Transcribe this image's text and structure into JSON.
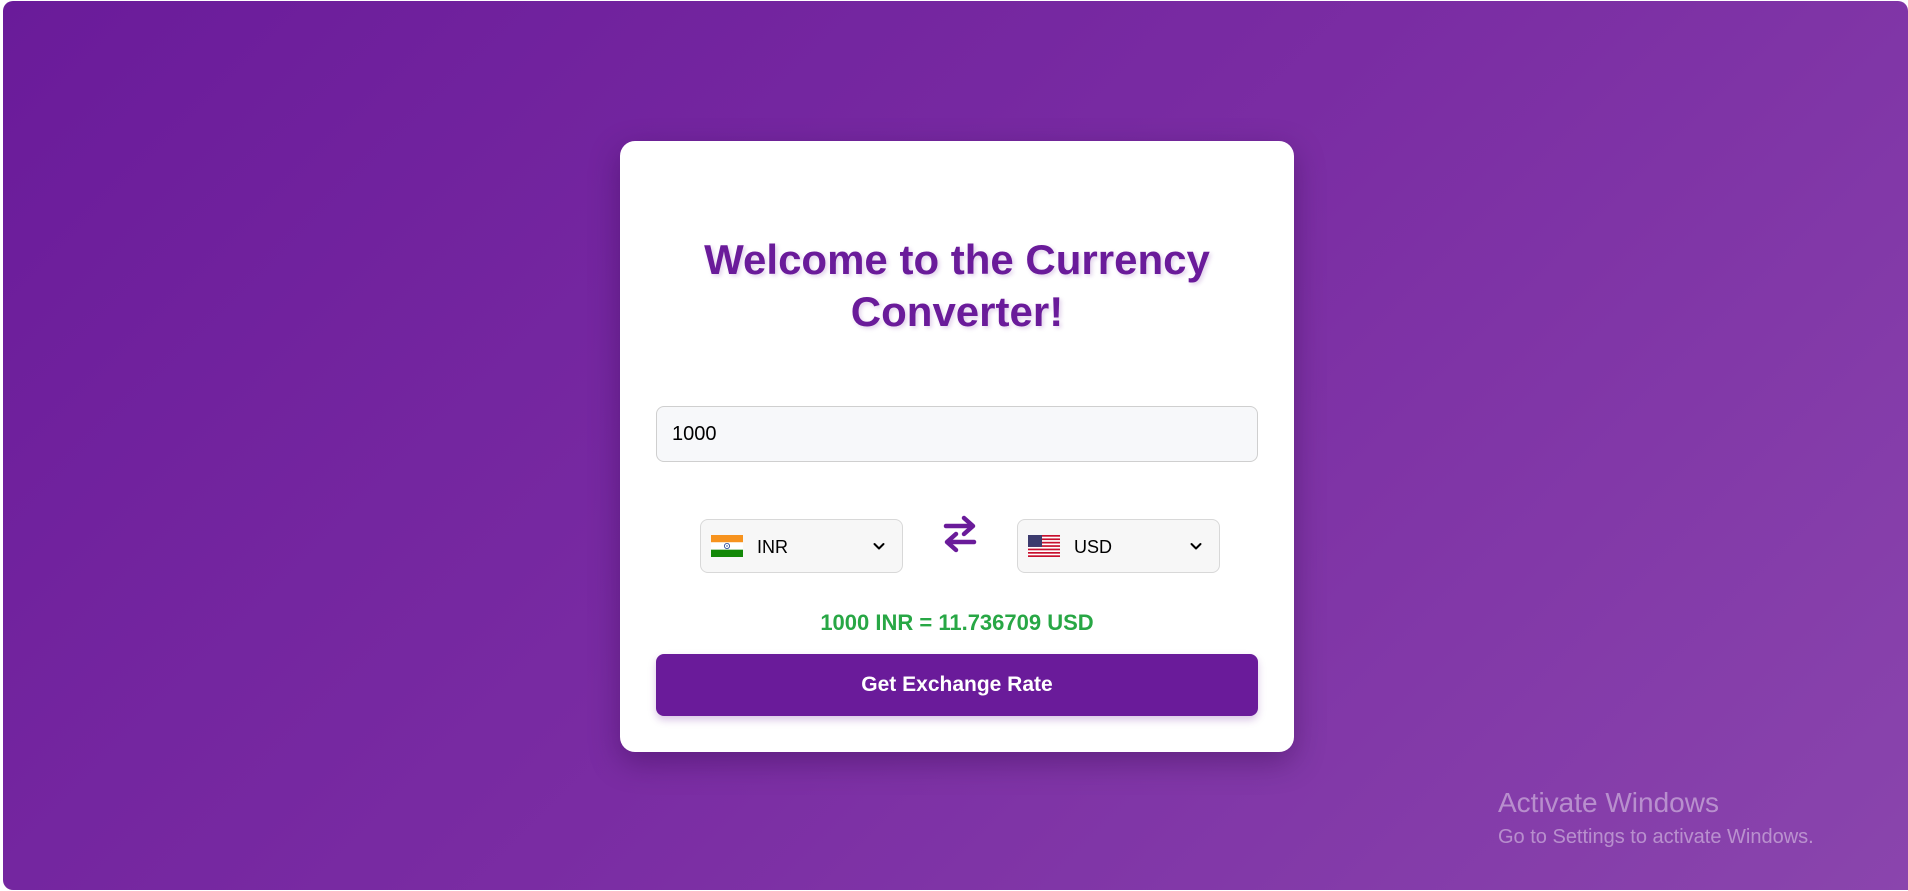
{
  "colors": {
    "brand": "#6a1b9a",
    "result": "#28a745",
    "card": "#ffffff"
  },
  "converter": {
    "title": "Welcome to the Currency Converter!",
    "amount_value": "1000",
    "from": {
      "code": "INR",
      "flag": "india-flag"
    },
    "to": {
      "code": "USD",
      "flag": "us-flag"
    },
    "swap_icon": "swap-arrows-icon",
    "result_text": "1000 INR = 11.736709 USD",
    "button_label": "Get Exchange Rate"
  },
  "watermark": {
    "title": "Activate Windows",
    "subtitle": "Go to Settings to activate Windows."
  }
}
